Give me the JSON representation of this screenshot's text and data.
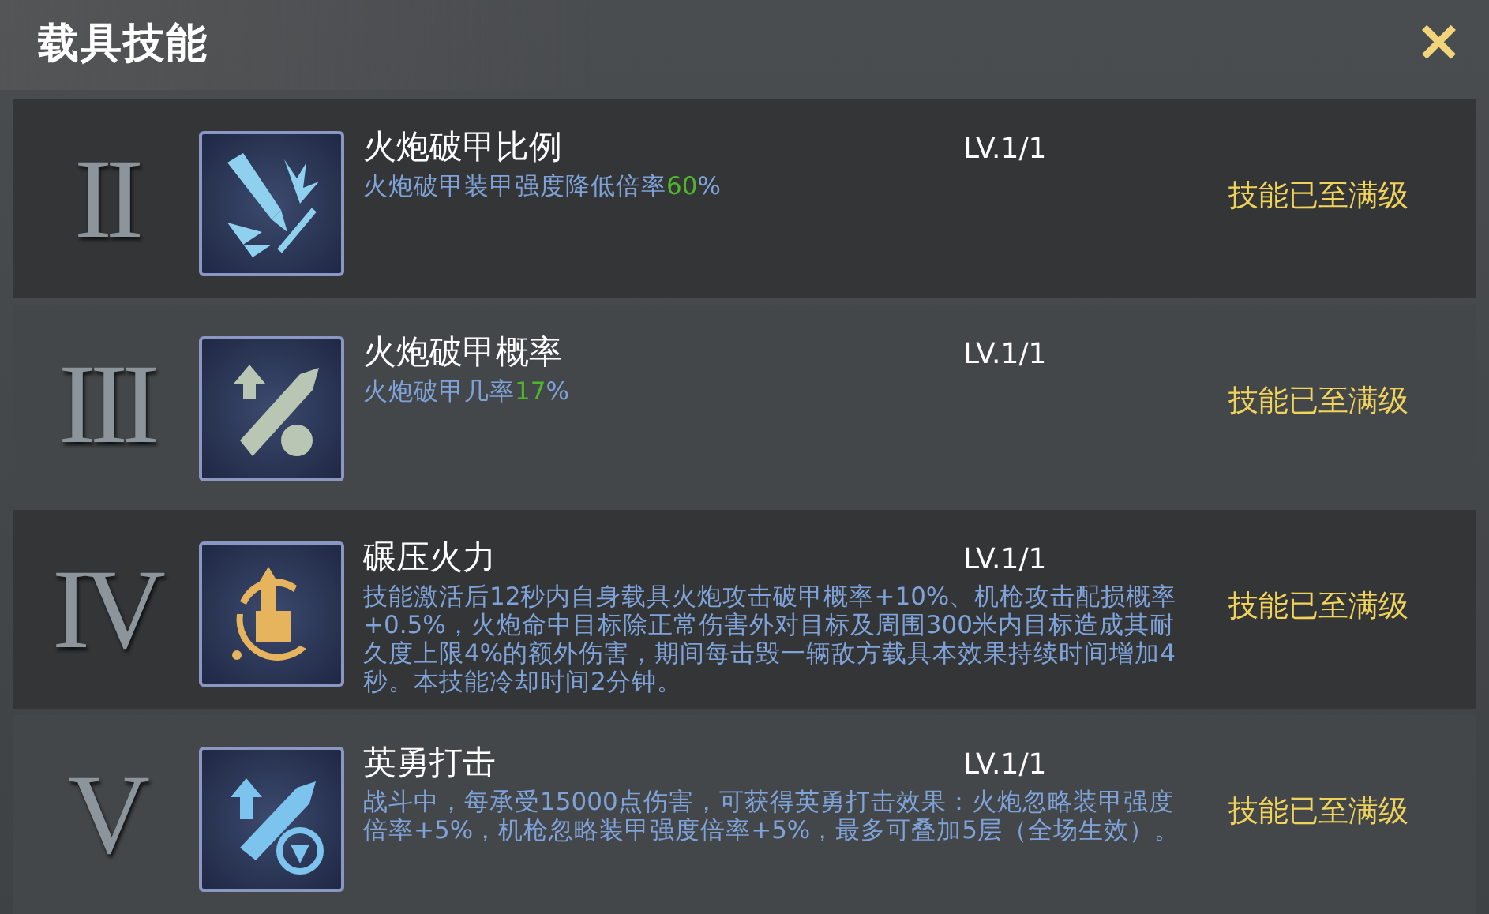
{
  "header": {
    "title": "载具技能",
    "close": "✕"
  },
  "skills": [
    {
      "numeral": "II",
      "name": "火炮破甲比例",
      "level": "LV.1/1",
      "description": "火炮破甲装甲强度降低倍率**60**%",
      "status": "技能已至满级"
    },
    {
      "numeral": "III",
      "name": "火炮破甲概率",
      "level": "LV.1/1",
      "description": "火炮破甲几率**17**%",
      "status": "技能已至满级"
    },
    {
      "numeral": "IV",
      "name": "碾压火力",
      "level": "LV.1/1",
      "description": "技能激活后12秒内自身载具火炮攻击破甲概率+10%、机枪攻击配损概率+0.5%，火炮命中目标除正常伤害外对目标及周围300米内目标造成其耐久度上限4%的额外伤害，期间每击毁一辆敌方载具本效果持续时间增加4秒。本技能冷却时间2分钟。",
      "status": "技能已至满级"
    },
    {
      "numeral": "V",
      "name": "英勇打击",
      "level": "LV.1/1",
      "description": "战斗中，每承受15000点伤害，可获得英勇打击效果：火炮忽略装甲强度倍率+5%，机枪忽略装甲强度倍率+5%，最多可叠加5层（全场生效）。",
      "status": "技能已至满级"
    }
  ]
}
